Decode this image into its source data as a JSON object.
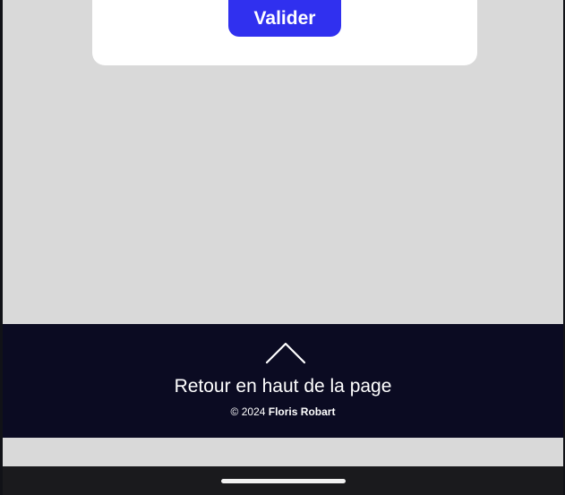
{
  "form": {
    "submit_label": "Valider"
  },
  "footer": {
    "back_to_top_label": "Retour en haut de la page",
    "back_to_top_icon": "chevron-up-icon",
    "copyright_prefix": "© 2024",
    "copyright_author": "Floris Robart"
  },
  "system_nav": {
    "home_indicator_icon": "home-indicator"
  },
  "colors": {
    "page_background": "#d9d9d9",
    "card_background": "#ffffff",
    "button_accent": "#3030ef",
    "footer_background": "#0b0b22",
    "nav_bar_background": "#1a1a1d"
  }
}
